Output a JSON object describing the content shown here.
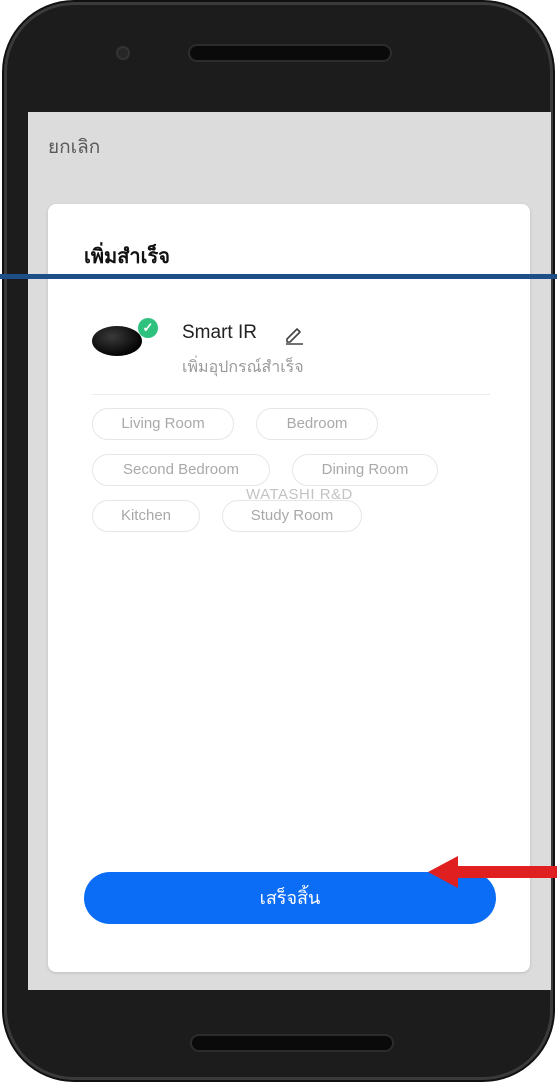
{
  "header": {
    "cancel_label": "ยกเลิก"
  },
  "dialog": {
    "title": "เพิ่มสำเร็จ",
    "device": {
      "name": "Smart IR",
      "status": "เพิ่มอุปกรณ์สำเร็จ",
      "icon": "ir-puck-image",
      "badge_icon": "check-icon",
      "edit_icon": "pencil-icon"
    },
    "rooms": [
      "Living Room",
      "Bedroom",
      "Second Bedroom",
      "Dining Room",
      "Kitchen",
      "Study Room"
    ],
    "watermark": "WATASHI R&D",
    "done_label": "เสร็จสิ้น"
  },
  "colors": {
    "primary": "#0b6cf5",
    "success": "#2ec27e",
    "annotation_line": "#1d4f86",
    "annotation_arrow": "#e02020"
  }
}
